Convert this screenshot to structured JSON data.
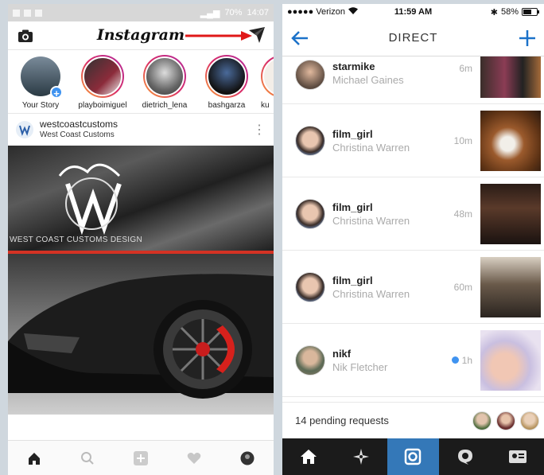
{
  "left_phone": {
    "status": {
      "battery": "70%",
      "time": "14:07"
    },
    "header": {
      "logo_text": "Instagram",
      "camera_icon": "camera-icon",
      "direct_icon": "paper-plane-icon",
      "annotation_icon": "red-arrow-icon"
    },
    "stories": [
      {
        "name": "Your Story",
        "own": true
      },
      {
        "name": "playboimiguel"
      },
      {
        "name": "dietrich_lena"
      },
      {
        "name": "bashgarza"
      },
      {
        "name": "ku"
      }
    ],
    "post": {
      "username": "westcoastcustoms",
      "subtitle": "West Coast Customs",
      "banner_text": "WEST COAST CUSTOMS DESIGN"
    },
    "tabs": [
      "home-icon",
      "search-icon",
      "add-icon",
      "heart-icon",
      "profile-icon"
    ]
  },
  "right_phone": {
    "status": {
      "carrier": "●●●●● Verizon",
      "time": "11:59 AM",
      "battery": "58%"
    },
    "nav": {
      "title": "DIRECT",
      "back_icon": "back-arrow-icon",
      "new_icon": "plus-icon"
    },
    "threads": [
      {
        "username": "starmike",
        "real_name": "Michael Gaines",
        "time": "6m",
        "unread": false
      },
      {
        "username": "film_girl",
        "real_name": "Christina Warren",
        "time": "10m",
        "unread": false
      },
      {
        "username": "film_girl",
        "real_name": "Christina Warren",
        "time": "48m",
        "unread": false
      },
      {
        "username": "film_girl",
        "real_name": "Christina Warren",
        "time": "60m",
        "unread": false
      },
      {
        "username": "nikf",
        "real_name": "Nik Fletcher",
        "time": "1h",
        "unread": true
      }
    ],
    "pending_requests": "14 pending requests",
    "tabs": [
      "home-icon",
      "explore-icon",
      "camera-icon",
      "activity-icon",
      "profile-icon"
    ]
  },
  "colors": {
    "accent_blue": "#1c72c9",
    "active_tab": "#3478b8",
    "red_line": "#d43224"
  }
}
